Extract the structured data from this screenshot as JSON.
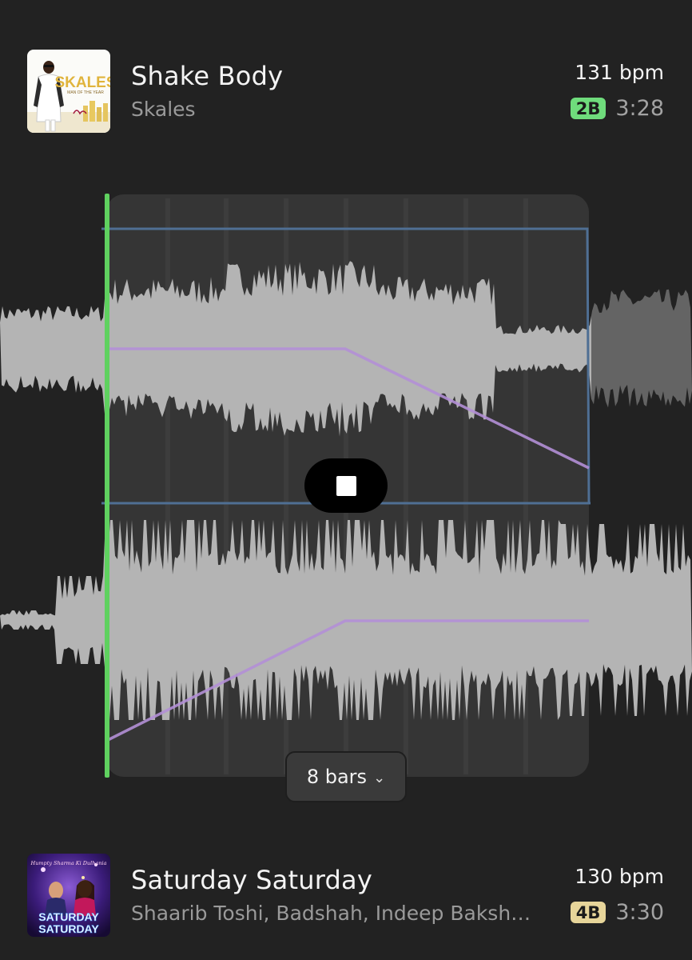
{
  "top_track": {
    "title": "Shake Body",
    "artist": "Skales",
    "bpm": "131 bpm",
    "key": "2B",
    "key_color": "#6fdc7c",
    "duration": "3:28",
    "cover_text": "SKALES",
    "cover_subtext": "MAN OF THE YEAR"
  },
  "transition": {
    "length_label": "8 bars",
    "length_chevron": "⌄",
    "play_state": "stop-icon",
    "playhead_color": "#5fd15f",
    "fade_out_color": "#b28fd6",
    "fade_in_color": "#b28fd6",
    "volume_line_color": "#4f6f94"
  },
  "bottom_track": {
    "title": "Saturday Saturday",
    "artist": "Shaarib Toshi, Badshah, Indeep Bakshi, Aastha Gill",
    "bpm": "130 bpm",
    "key": "4B",
    "key_color": "#e7d59a",
    "duration": "3:30",
    "cover_text_line1": "SATURDAY",
    "cover_text_line2": "SATURDAY",
    "cover_script": "Humpty Sharma Ki Dulhania"
  }
}
